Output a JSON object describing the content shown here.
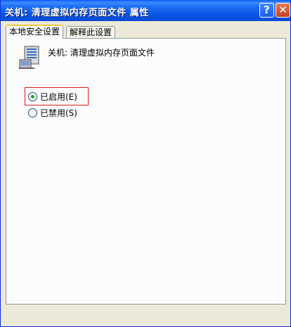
{
  "window": {
    "title": "关机: 清理虚拟内存页面文件 属性",
    "help_label": "?",
    "close_label": "✕"
  },
  "tabs": [
    {
      "label": "本地安全设置",
      "active": true
    },
    {
      "label": "解释此设置",
      "active": false
    }
  ],
  "policy": {
    "icon": "policy-computer-icon",
    "name": "关机: 清理虚拟内存页面文件"
  },
  "options": [
    {
      "label": "已启用(E)",
      "checked": true
    },
    {
      "label": "已禁用(S)",
      "checked": false
    }
  ],
  "colors": {
    "titlebar": "#0a55e6",
    "highlight": "#d41a1a",
    "radio_dot": "#21a121",
    "active_tab_accent": "#ffc83c"
  }
}
